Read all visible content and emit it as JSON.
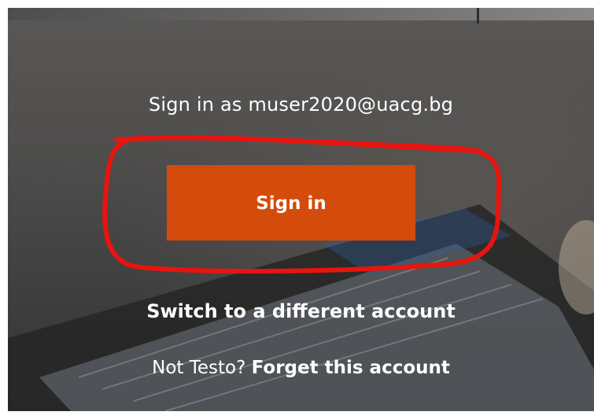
{
  "colors": {
    "accent": "#d44b0b",
    "annotation": "#e8140f",
    "text": "#ffffff"
  },
  "signin_prompt": {
    "label": "Sign in as",
    "account": "muser2020@uacg.bg"
  },
  "signin_button": {
    "label": "Sign in"
  },
  "switch_account": {
    "label": "Switch to a different account"
  },
  "forget": {
    "prefix": "Not Testo?",
    "link_label": "Forget this account"
  }
}
